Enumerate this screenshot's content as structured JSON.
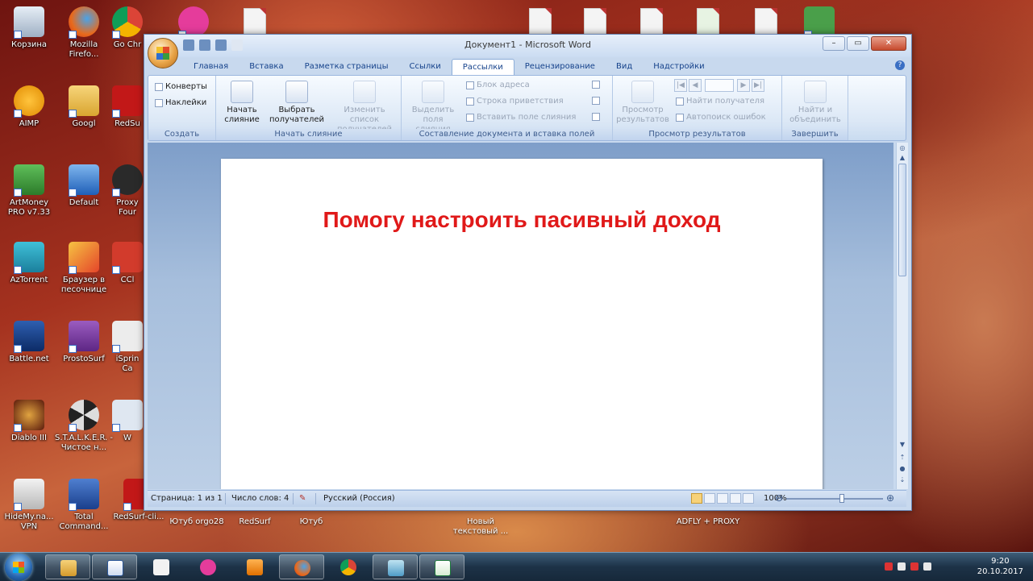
{
  "desktop": {
    "icons": [
      {
        "label": "Корзина"
      },
      {
        "label": "Mozilla Firefo..."
      },
      {
        "label": "Go Chr"
      },
      {
        "label": "AIMP"
      },
      {
        "label": "Googl"
      },
      {
        "label": "RedSu"
      },
      {
        "label": "ArtMoney PRO v7.33"
      },
      {
        "label": "Default"
      },
      {
        "label": "Proxy Four"
      },
      {
        "label": "AzTorrent"
      },
      {
        "label": "Браузер в песочнице"
      },
      {
        "label": "CCl"
      },
      {
        "label": "Battle.net"
      },
      {
        "label": "ProstoSurf"
      },
      {
        "label": "iSprin Ca"
      },
      {
        "label": "Diablo III"
      },
      {
        "label": "S.T.A.L.K.E.R. - Чистое н..."
      },
      {
        "label": "W"
      },
      {
        "label": "HideMy.na... VPN"
      },
      {
        "label": "Total Command..."
      },
      {
        "label": "RedSurf-cli..."
      }
    ],
    "bottom_labels": [
      "Ютуб orgo28",
      "RedSurf",
      "Ютуб",
      "Новый текстовый ...",
      "ADFLY + PROXY"
    ]
  },
  "word": {
    "title": "Документ1 - Microsoft Word",
    "tabs": [
      "Главная",
      "Вставка",
      "Разметка страницы",
      "Ссылки",
      "Рассылки",
      "Рецензирование",
      "Вид",
      "Надстройки"
    ],
    "active_tab": "Рассылки",
    "ribbon": {
      "create": {
        "label": "Создать",
        "envelopes": "Конверты",
        "labels": "Наклейки"
      },
      "start_merge": {
        "label": "Начать слияние",
        "start_btn": "Начать слияние",
        "select_btn": "Выбрать получателей",
        "edit_btn": "Изменить список получателей"
      },
      "fields": {
        "label": "Составление документа и вставка полей",
        "highlight_btn": "Выделить поля слияния",
        "address_block": "Блок адреса",
        "greeting_line": "Строка приветствия",
        "insert_field": "Вставить поле слияния"
      },
      "preview": {
        "label": "Просмотр результатов",
        "preview_btn": "Просмотр результатов",
        "find_recipient": "Найти получателя",
        "auto_check": "Автопоиск ошибок"
      },
      "finish": {
        "label": "Завершить",
        "finish_btn": "Найти и объединить"
      }
    },
    "document": {
      "heading": "Помогу настроить пасивный доход"
    },
    "status": {
      "page": "Страница: 1 из 1",
      "words": "Число слов: 4",
      "language": "Русский (Россия)",
      "zoom": "100%",
      "zoom_percent": 100
    }
  },
  "taskbar": {
    "time": "9:20",
    "date": "20.10.2017"
  },
  "colors": {
    "heading_red": "#e01919",
    "ribbon_blue": "#15428b"
  }
}
